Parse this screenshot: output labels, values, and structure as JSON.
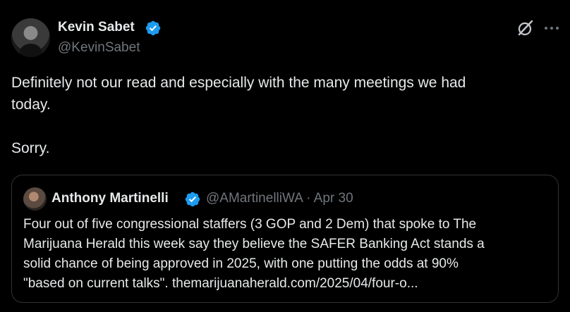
{
  "post": {
    "author_name": "Kevin Sabet",
    "author_handle": "@KevinSabet",
    "text_lines": [
      "Definitely not our read and especially with the many meetings we had",
      "today.",
      "Sorry."
    ]
  },
  "quoted_post": {
    "author_name": "Anthony Martinelli",
    "author_meta": "@AMartinelliWA · Apr 30",
    "text_lines": [
      "Four out of five congressional staffers (3 GOP and 2 Dem) that spoke to The",
      "Marijuana Herald this week say they believe the SAFER Banking Act stands a",
      "solid chance of being approved in 2025, with one putting the odds at 90%",
      "\"based on current talks\".  themarijuanaherald.com/2025/04/four-o..."
    ]
  },
  "icons": {
    "verified": "verified-badge-icon",
    "grok": "grok-icon",
    "more": "more-options-icon"
  },
  "colors": {
    "background": "#000000",
    "primary_text": "#e7e9ea",
    "secondary_text": "#71767b",
    "verified_blue": "#1d9bf0",
    "border": "#2f3336"
  }
}
